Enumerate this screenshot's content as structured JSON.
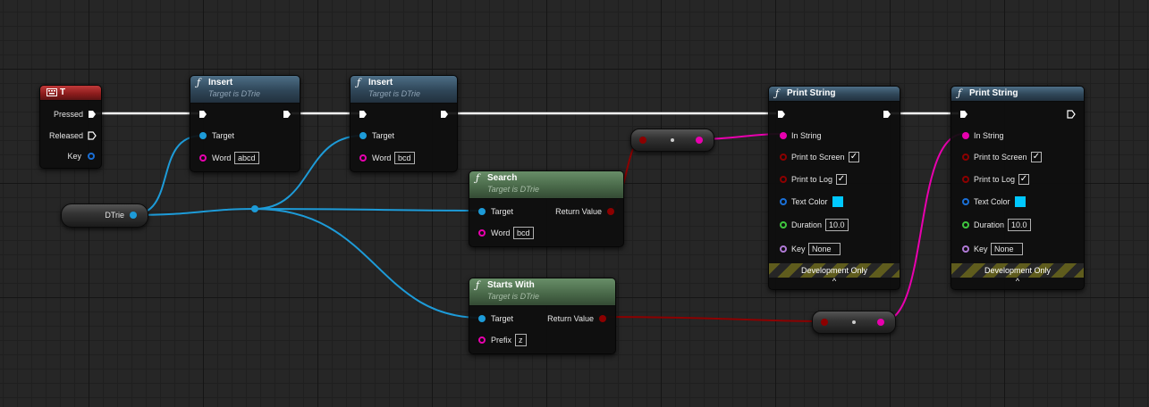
{
  "colors": {
    "exec": "#ffffff",
    "object": "#1d9bd8",
    "string": "#e800ae",
    "bool": "#8c0000",
    "struct": "#1a6fd6",
    "float": "#3fc63f",
    "name": "#b07ad6"
  },
  "event": {
    "icon": "keyboard-icon",
    "title": "T",
    "pins": [
      "Pressed",
      "Released",
      "Key"
    ]
  },
  "variable": {
    "label": "DTrie"
  },
  "insert1": {
    "title": "Insert",
    "subtitle": "Target is DTrie",
    "target": "Target",
    "word_label": "Word",
    "word_value": "abcd"
  },
  "insert2": {
    "title": "Insert",
    "subtitle": "Target is DTrie",
    "target": "Target",
    "word_label": "Word",
    "word_value": "bcd"
  },
  "search": {
    "title": "Search",
    "subtitle": "Target is DTrie",
    "target": "Target",
    "return": "Return Value",
    "word_label": "Word",
    "word_value": "bcd"
  },
  "starts_with": {
    "title": "Starts With",
    "subtitle": "Target is DTrie",
    "target": "Target",
    "return": "Return Value",
    "prefix_label": "Prefix",
    "prefix_value": "z"
  },
  "print1": {
    "title": "Print String",
    "in_string": "In String",
    "print_screen": "Print to Screen",
    "print_screen_checked": true,
    "print_log": "Print to Log",
    "print_log_checked": true,
    "text_color": "Text Color",
    "text_color_value": "#00c8ff",
    "duration": "Duration",
    "duration_value": "10.0",
    "key": "Key",
    "key_value": "None",
    "dev_only": "Development Only",
    "caret": "^"
  },
  "print2": {
    "title": "Print String",
    "in_string": "In String",
    "print_screen": "Print to Screen",
    "print_screen_checked": true,
    "print_log": "Print to Log",
    "print_log_checked": true,
    "text_color": "Text Color",
    "text_color_value": "#00c8ff",
    "duration": "Duration",
    "duration_value": "10.0",
    "key": "Key",
    "key_value": "None",
    "dev_only": "Development Only",
    "caret": "^"
  },
  "function_icon": "function-icon",
  "check_glyph": "✓"
}
